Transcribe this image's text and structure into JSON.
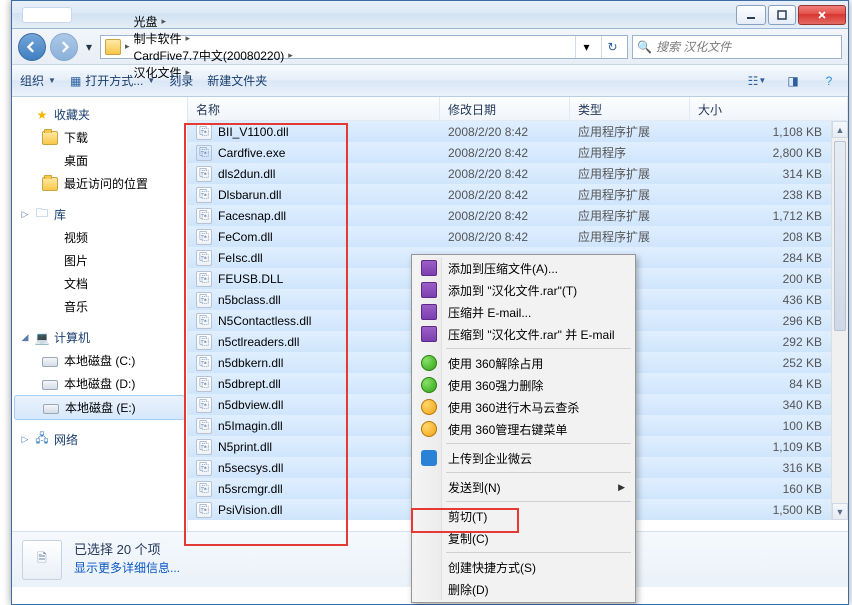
{
  "titlebar": {},
  "nav": {
    "breadcrumbs": [
      "光盘",
      "制卡软件",
      "CardFive7.7中文(20080220)",
      "汉化文件"
    ],
    "search_placeholder": "搜索 汉化文件"
  },
  "toolbar": {
    "organize": "组织",
    "open_with": "打开方式...",
    "burn": "刻录",
    "new_folder": "新建文件夹"
  },
  "columns": {
    "name": "名称",
    "date": "修改日期",
    "type": "类型",
    "size": "大小"
  },
  "sidebar": {
    "favorites": {
      "label": "收藏夹",
      "items": [
        "下载",
        "桌面",
        "最近访问的位置"
      ]
    },
    "libraries": {
      "label": "库",
      "items": [
        "视频",
        "图片",
        "文档",
        "音乐"
      ]
    },
    "computer": {
      "label": "计算机",
      "items": [
        "本地磁盘 (C:)",
        "本地磁盘 (D:)",
        "本地磁盘 (E:)"
      ],
      "selected": 2
    },
    "network": {
      "label": "网络"
    }
  },
  "files": [
    {
      "name": "BII_V1100.dll",
      "date": "2008/2/20 8:42",
      "type": "应用程序扩展",
      "size": "1,108 KB"
    },
    {
      "name": "Cardfive.exe",
      "date": "2008/2/20 8:42",
      "type": "应用程序",
      "size": "2,800 KB",
      "exe": true
    },
    {
      "name": "dls2dun.dll",
      "date": "2008/2/20 8:42",
      "type": "应用程序扩展",
      "size": "314 KB"
    },
    {
      "name": "Dlsbarun.dll",
      "date": "2008/2/20 8:42",
      "type": "应用程序扩展",
      "size": "238 KB"
    },
    {
      "name": "Facesnap.dll",
      "date": "2008/2/20 8:42",
      "type": "应用程序扩展",
      "size": "1,712 KB"
    },
    {
      "name": "FeCom.dll",
      "date": "2008/2/20 8:42",
      "type": "应用程序扩展",
      "size": "208 KB"
    },
    {
      "name": "FeIsc.dll",
      "date": "",
      "type": "",
      "size": "284 KB"
    },
    {
      "name": "FEUSB.DLL",
      "date": "",
      "type": "",
      "size": "200 KB"
    },
    {
      "name": "n5bclass.dll",
      "date": "",
      "type": "",
      "size": "436 KB"
    },
    {
      "name": "N5Contactless.dll",
      "date": "",
      "type": "",
      "size": "296 KB"
    },
    {
      "name": "n5ctlreaders.dll",
      "date": "",
      "type": "",
      "size": "292 KB"
    },
    {
      "name": "n5dbkern.dll",
      "date": "",
      "type": "",
      "size": "252 KB"
    },
    {
      "name": "n5dbrept.dll",
      "date": "",
      "type": "",
      "size": "84 KB"
    },
    {
      "name": "n5dbview.dll",
      "date": "",
      "type": "",
      "size": "340 KB"
    },
    {
      "name": "n5Imagin.dll",
      "date": "",
      "type": "",
      "size": "100 KB"
    },
    {
      "name": "N5print.dll",
      "date": "",
      "type": "",
      "size": "1,109 KB"
    },
    {
      "name": "n5secsys.dll",
      "date": "",
      "type": "",
      "size": "316 KB"
    },
    {
      "name": "n5srcmgr.dll",
      "date": "",
      "type": "",
      "size": "160 KB"
    },
    {
      "name": "PsiVision.dll",
      "date": "",
      "type": "",
      "size": "1,500 KB"
    }
  ],
  "context_menu": [
    {
      "label": "添加到压缩文件(A)...",
      "icon": "rar"
    },
    {
      "label": "添加到 \"汉化文件.rar\"(T)",
      "icon": "rar"
    },
    {
      "label": "压缩并 E-mail...",
      "icon": "rar"
    },
    {
      "label": "压缩到 \"汉化文件.rar\" 并 E-mail",
      "icon": "rar"
    },
    {
      "sep": true
    },
    {
      "label": "使用 360解除占用",
      "icon": "g360"
    },
    {
      "label": "使用 360强力删除",
      "icon": "g360"
    },
    {
      "label": "使用 360进行木马云查杀",
      "icon": "o360"
    },
    {
      "label": "使用 360管理右键菜单",
      "icon": "o360"
    },
    {
      "sep": true
    },
    {
      "label": "上传到企业微云",
      "icon": "wx"
    },
    {
      "sep": true
    },
    {
      "label": "发送到(N)",
      "sub": true
    },
    {
      "sep": true
    },
    {
      "label": "剪切(T)"
    },
    {
      "label": "复制(C)"
    },
    {
      "sep": true
    },
    {
      "label": "创建快捷方式(S)"
    },
    {
      "label": "删除(D)"
    }
  ],
  "details": {
    "title": "已选择 20 个项",
    "more": "显示更多详细信息..."
  }
}
